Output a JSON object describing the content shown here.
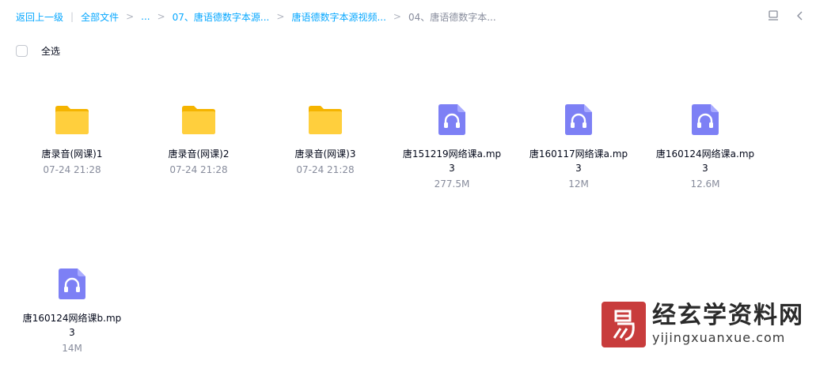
{
  "breadcrumb": {
    "back": "返回上一级",
    "root": "全部文件",
    "ellipsis": "...",
    "level1": "07、唐语德数字本源...",
    "level2": "唐语德数字本源视频...",
    "current": "04、唐语德数字本...",
    "separator": ">",
    "divider": "|"
  },
  "toolbar": {
    "select_all_label": "全选"
  },
  "colors": {
    "link": "#06a7ff",
    "folder": "#ffc83d",
    "audio": "#7b7ff6",
    "muted": "#878c9c"
  },
  "files": [
    {
      "type": "folder",
      "name": "唐录音(网课)1",
      "meta": "07-24 21:28",
      "icon": "folder-icon"
    },
    {
      "type": "folder",
      "name": "唐录音(网课)2",
      "meta": "07-24 21:28",
      "icon": "folder-icon"
    },
    {
      "type": "folder",
      "name": "唐录音(网课)3",
      "meta": "07-24 21:28",
      "icon": "folder-icon"
    },
    {
      "type": "audio",
      "name": "唐151219网络课a.mp3",
      "meta": "277.5M",
      "icon": "audio-file-icon"
    },
    {
      "type": "audio",
      "name": "唐160117网络课a.mp3",
      "meta": "12M",
      "icon": "audio-file-icon"
    },
    {
      "type": "audio",
      "name": "唐160124网络课a.mp3",
      "meta": "12.6M",
      "icon": "audio-file-icon"
    },
    {
      "type": "audio",
      "name": "唐160124网络课b.mp3",
      "meta": "14M",
      "icon": "audio-file-icon"
    }
  ],
  "watermark": {
    "title": "经玄学资料网",
    "url": "yijingxuanxue.com"
  }
}
